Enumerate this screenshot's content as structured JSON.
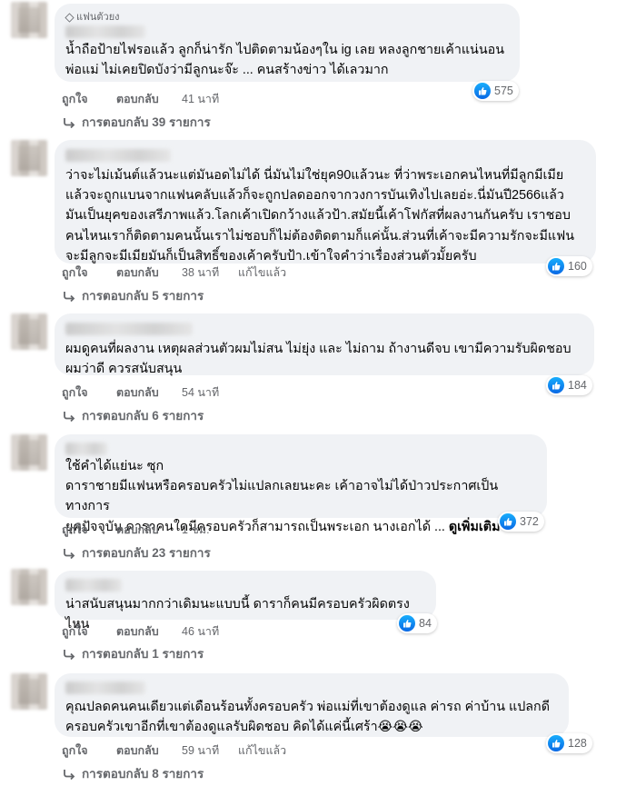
{
  "labels": {
    "like": "ถูกใจ",
    "reply": "ตอบกลับ",
    "edited": "แก้ไขแล้ว"
  },
  "colors": {
    "bubble": "#f0f2f5",
    "secondary_text": "#65676b",
    "like_blue": "#1877f2"
  },
  "comments": [
    {
      "badge": "แฟนตัวยง",
      "text": "น้ำถือป้ายไฟรอแล้ว ลูกก็น่ารัก ไปติดตามน้องๆใน ig เลย หลงลูกชายเค้าแน่นอน\nพ่อแม่ ไม่เคยปิดบังว่ามีลูกนะจ๊ะ ... คนสร้างข่าว ได้เลวมาก",
      "time": "41 นาที",
      "reactions": "575",
      "replies": "การตอบกลับ 39 รายการ"
    },
    {
      "text": "ว่าจะไม่เม้นต์แล้วนะแต่มันอดไม่ได้ นี่มันไม่ใช่ยุค90แล้วนะ ที่ว่าพระเอกคนไหนที่มีลูกมีเมีย\nแล้วจะถูกแบนจากแฟนคลับแล้วก็จะถูกปลดออกจากวงการบันเทิงไปเลยอ่ะ.นี่มันปี2566แล้ว\nมันเป็นยุคของเสรีภาพแล้ว.โลกเค้าเปิดกว้างแล้วป้า.สมัยนี้เค้าโฟกัสที่ผลงานกันครับ เราชอบ\nคนไหนเราก็ติดตามคนนั้นเราไม่ชอบก็ไม่ต้องติดตามก็แค่นั้น.ส่วนที่เค้าจะมีความรักจะมีแฟน\nจะมีลูกจะมีเมียมันก็เป็นสิทธิ์ของเค้าครับป้า.เข้าใจคำว่าเรื่องส่วนตัวมั้ยครับ",
      "time": "38 นาที",
      "edited": true,
      "reactions": "160",
      "replies": "การตอบกลับ 5 รายการ"
    },
    {
      "text": "ผมดูคนที่ผลงาน เหตุผลส่วนตัวผมไม่สน ไม่ยุ่ง และ ไม่ถาม ถ้างานดีจบ เขามีความรับผิดชอบ\nผมว่าดี ควรสนับสนุน",
      "time": "54 นาที",
      "reactions": "184",
      "replies": "การตอบกลับ 6 รายการ"
    },
    {
      "text": "ใช้คำได้แย่นะ ซุก\nดาราชายมีแฟนหรือครอบครัวไม่แปลกเลยนะคะ เค้าอาจไม่ได้ป่าวประกาศเป็นทางการ\nยุคปัจจุบัน ดาราคนใดมีครอบครัวก็สามารถเป็นพระเอก นางเอกได้ ...",
      "see_more": "ดูเพิ่มเติม",
      "time": "1 ชม.",
      "reactions": "372",
      "replies": "การตอบกลับ 23 รายการ"
    },
    {
      "text": "น่าสนับสนุนมากกว่าเดิมนะแบบนี้ ดาราก็คนมีครอบครัวผิดตรงไหน",
      "time": "46 นาที",
      "reactions": "84",
      "replies": "การตอบกลับ 1 รายการ"
    },
    {
      "text": "คุณปลดคนคนเดียวแต่เดือนร้อนทั้งครอบครัว พ่อแม่ที่เขาต้องดูแล ค่ารถ ค่าบ้าน แปลกดี\nครอบครัวเขาอีกที่เขาต้องดูแลรับผิดชอบ คิดได้แค่นี้เศร้า😭😭😭",
      "time": "59 นาที",
      "edited": true,
      "reactions": "128",
      "replies": "การตอบกลับ 8 รายการ"
    }
  ]
}
